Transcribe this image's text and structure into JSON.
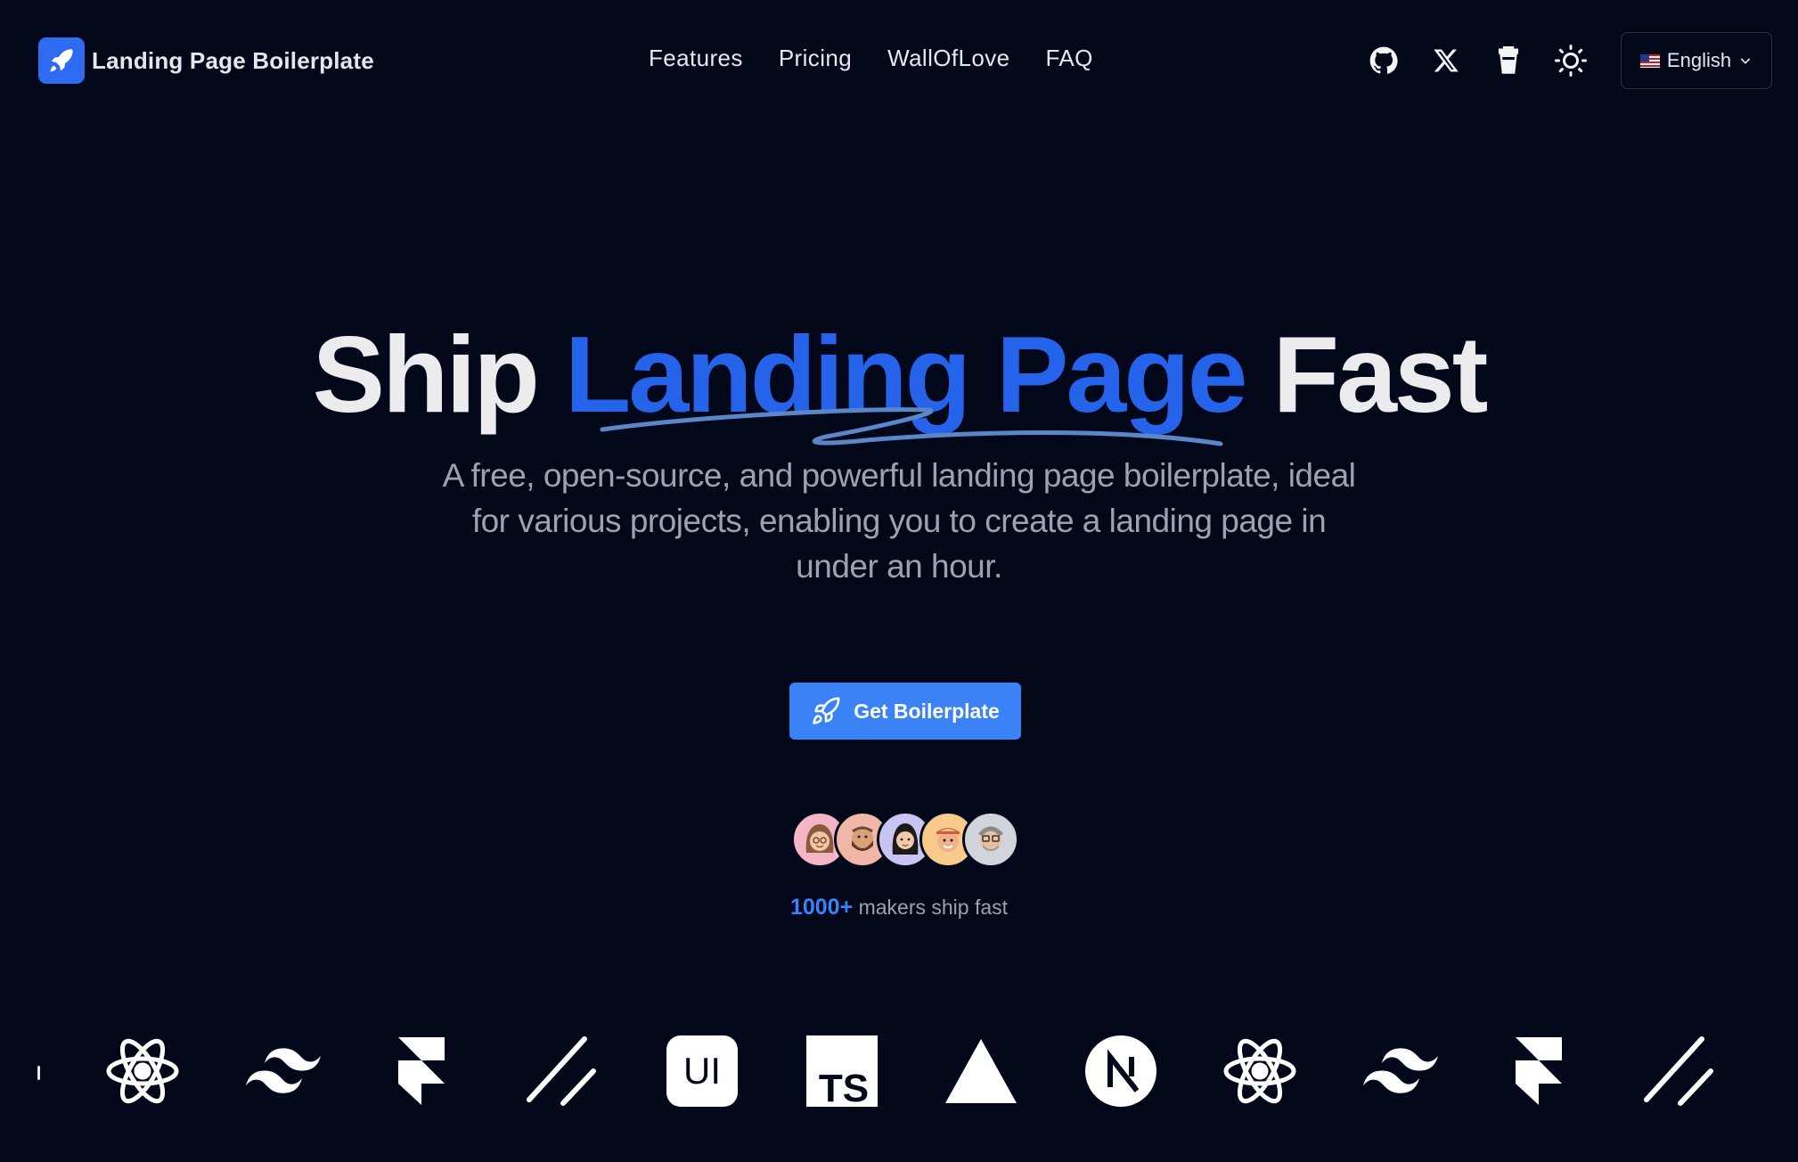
{
  "header": {
    "brand_name": "Landing Page Boilerplate",
    "nav": [
      "Features",
      "Pricing",
      "WallOfLove",
      "FAQ"
    ],
    "icons": [
      "github-icon",
      "x-twitter-icon",
      "buy-me-a-coffee-icon",
      "theme-toggle-sun-icon"
    ],
    "language": "English"
  },
  "hero": {
    "title_start": "Ship ",
    "title_accent": "Landing Page",
    "title_end": " Fast",
    "subtitle": "A free, open-source, and powerful landing page boilerplate, ideal for various projects, enabling you to create a landing page in under an hour.",
    "cta_label": "Get Boilerplate"
  },
  "social_proof": {
    "count": "1000+",
    "text": " makers ship fast"
  },
  "tech_logos": [
    "react-icon",
    "tailwind-icon",
    "framer-icon",
    "shadcn-icon",
    "shadcn-ui-icon",
    "typescript-icon",
    "vercel-icon",
    "nextjs-icon",
    "react-icon",
    "tailwind-icon",
    "framer-icon",
    "shadcn-icon"
  ],
  "colors": {
    "background": "#03071a",
    "accent": "#2563eb",
    "cta": "#3b82f6"
  }
}
